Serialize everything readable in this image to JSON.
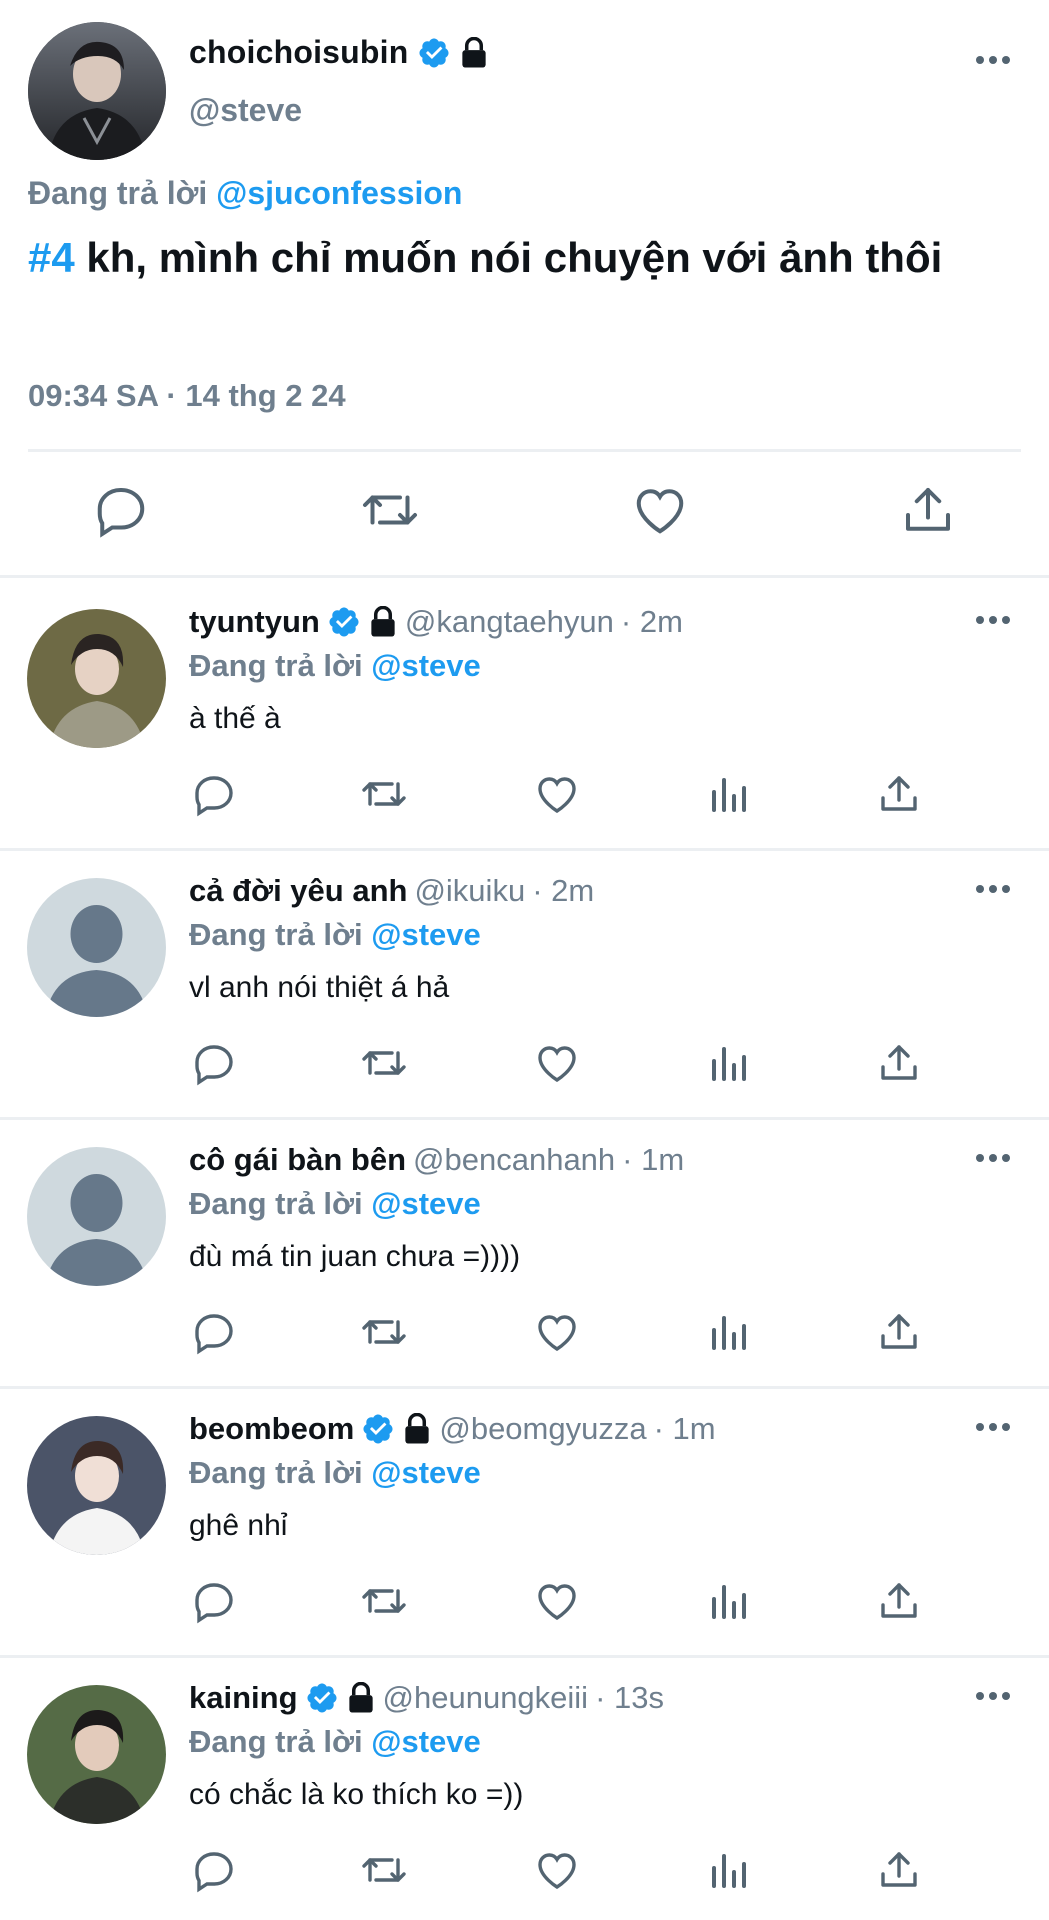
{
  "main_tweet": {
    "display_name": "choichoisubin",
    "handle": "@steve",
    "replying_prefix": "Đang trả lời",
    "replying_to": "@sjuconfession",
    "hashtag": "#4",
    "text": " kh, mình chỉ muốn nói chuyện với ảnh thôi",
    "timestamp": "09:34 SA · 14 thg 2 24",
    "verified": true,
    "protected": true
  },
  "replies": [
    {
      "display_name": "tyuntyun",
      "verified": true,
      "protected": true,
      "handle": "@kangtaehyun",
      "time": "· 2m",
      "replying_prefix": "Đang trả lời",
      "replying_to": "@steve",
      "text": "à thế à",
      "avatar": "photo"
    },
    {
      "display_name": "cả đời yêu anh",
      "verified": false,
      "protected": false,
      "handle": "@ikuiku",
      "time": "· 2m",
      "replying_prefix": "Đang trả lời",
      "replying_to": "@steve",
      "text": "vl anh nói thiệt á hả",
      "avatar": "default"
    },
    {
      "display_name": "cô gái bàn bên",
      "verified": false,
      "protected": false,
      "handle": "@bencanhanh",
      "time": "· 1m",
      "replying_prefix": "Đang trả lời",
      "replying_to": "@steve",
      "text": "đù má tin juan chưa =))))",
      "avatar": "default"
    },
    {
      "display_name": "beombeom",
      "verified": true,
      "protected": true,
      "handle": "@beomgyuzza",
      "time": "· 1m",
      "replying_prefix": "Đang trả lời",
      "replying_to": "@steve",
      "text": "ghê nhỉ",
      "avatar": "photo"
    },
    {
      "display_name": "kaining",
      "verified": true,
      "protected": true,
      "handle": "@heunungkeiii",
      "time": "· 13s",
      "replying_prefix": "Đang trả lời",
      "replying_to": "@steve",
      "text": "có chắc là ko thích ko =))",
      "avatar": "photo"
    }
  ],
  "colors": {
    "accent": "#1d9bf0",
    "secondary_text": "#6f7f8e",
    "divider": "#eceff2",
    "default_avatar_bg": "#cfd9de",
    "default_avatar_fg": "#66788a"
  }
}
